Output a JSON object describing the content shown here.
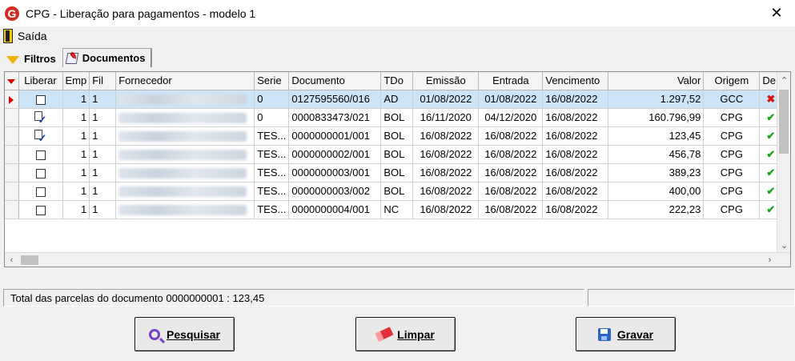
{
  "window": {
    "title": "CPG - Liberação para pagamentos - modelo 1",
    "logo_letter": "G",
    "close_glyph": "✕"
  },
  "menu": {
    "exit_label": "Saída"
  },
  "tabs": [
    {
      "label": "Filtros"
    },
    {
      "label": "Documentos"
    }
  ],
  "grid": {
    "columns": [
      "Liberar",
      "Emp",
      "Fil",
      "Fornecedor",
      "Serie",
      "Documento",
      "TDo",
      "Emissão",
      "Entrada",
      "Vencimento",
      "Valor",
      "Origem",
      "De"
    ],
    "rows": [
      {
        "liberar": "checkbox",
        "emp": "1",
        "fil": "1",
        "serie": "0",
        "documento": "0127595560/016",
        "tdo": "AD",
        "emissao": "01/08/2022",
        "entrada": "01/08/2022",
        "vencimento": "16/08/2022",
        "valor": "1.297,52",
        "origem": "GCC",
        "status": "✖"
      },
      {
        "liberar": "released",
        "emp": "1",
        "fil": "1",
        "serie": "0",
        "documento": "0000833473/021",
        "tdo": "BOL",
        "emissao": "16/11/2020",
        "entrada": "04/12/2020",
        "vencimento": "16/08/2022",
        "valor": "160.796,99",
        "origem": "CPG",
        "status": "✔"
      },
      {
        "liberar": "released",
        "emp": "1",
        "fil": "1",
        "serie": "TES...",
        "documento": "0000000001/001",
        "tdo": "BOL",
        "emissao": "16/08/2022",
        "entrada": "16/08/2022",
        "vencimento": "16/08/2022",
        "valor": "123,45",
        "origem": "CPG",
        "status": "✔"
      },
      {
        "liberar": "checkbox",
        "emp": "1",
        "fil": "1",
        "serie": "TES...",
        "documento": "0000000002/001",
        "tdo": "BOL",
        "emissao": "16/08/2022",
        "entrada": "16/08/2022",
        "vencimento": "16/08/2022",
        "valor": "456,78",
        "origem": "CPG",
        "status": "✔"
      },
      {
        "liberar": "checkbox",
        "emp": "1",
        "fil": "1",
        "serie": "TES...",
        "documento": "0000000003/001",
        "tdo": "BOL",
        "emissao": "16/08/2022",
        "entrada": "16/08/2022",
        "vencimento": "16/08/2022",
        "valor": "389,23",
        "origem": "CPG",
        "status": "✔"
      },
      {
        "liberar": "checkbox",
        "emp": "1",
        "fil": "1",
        "serie": "TES...",
        "documento": "0000000003/002",
        "tdo": "BOL",
        "emissao": "16/08/2022",
        "entrada": "16/08/2022",
        "vencimento": "16/08/2022",
        "valor": "400,00",
        "origem": "CPG",
        "status": "✔"
      },
      {
        "liberar": "checkbox",
        "emp": "1",
        "fil": "1",
        "serie": "TES...",
        "documento": "0000000004/001",
        "tdo": "NC",
        "emissao": "16/08/2022",
        "entrada": "16/08/2022",
        "vencimento": "16/08/2022",
        "valor": "222,23",
        "origem": "CPG",
        "status": "✔"
      }
    ]
  },
  "status": {
    "text": "Total das parcelas do documento  0000000001 :   123,45"
  },
  "buttons": {
    "search": "Pesquisar",
    "clear": "Limpar",
    "save": "Gravar"
  },
  "colors": {
    "selected_row": "#cce4f7",
    "ok": "#1aa51a",
    "error": "#e01010",
    "logo": "#d42a24"
  }
}
